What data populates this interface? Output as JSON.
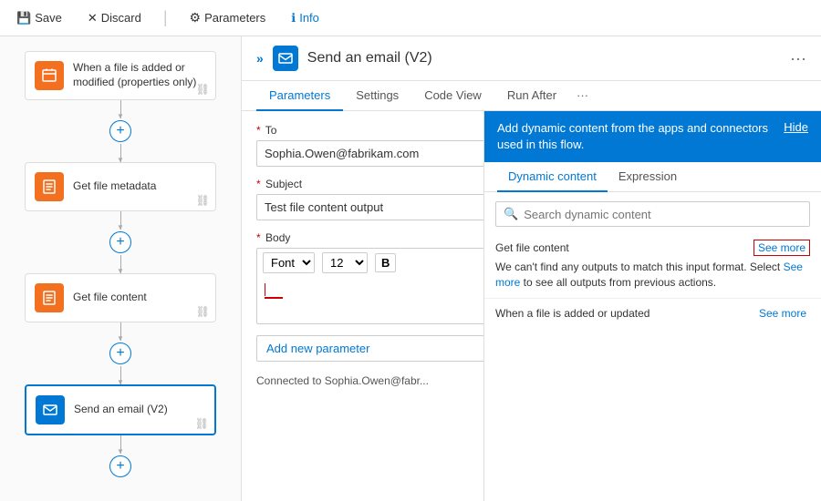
{
  "toolbar": {
    "save_label": "Save",
    "discard_label": "Discard",
    "parameters_label": "Parameters",
    "info_label": "Info"
  },
  "sidebar": {
    "nodes": [
      {
        "id": "trigger",
        "label": "When a file is added or modified (properties only)",
        "icon": "📁",
        "active": false
      },
      {
        "id": "get-metadata",
        "label": "Get file metadata",
        "icon": "📋",
        "active": false
      },
      {
        "id": "get-content",
        "label": "Get file content",
        "icon": "📄",
        "active": false
      },
      {
        "id": "send-email",
        "label": "Send an email (V2)",
        "icon": "✉",
        "active": true
      }
    ]
  },
  "action": {
    "title": "Send an email (V2)",
    "icon": "✉"
  },
  "tabs": {
    "items": [
      "Parameters",
      "Settings",
      "Code View",
      "Run After"
    ],
    "active": "Parameters"
  },
  "form": {
    "to_label": "To",
    "to_value": "Sophia.Owen@fabrikam.com",
    "subject_label": "Subject",
    "subject_value": "Test file content output",
    "body_label": "Body",
    "body_font": "Font",
    "body_size": "12",
    "add_param_label": "Add new parameter",
    "connected_text": "Connected to  Sophia.Owen@fabr..."
  },
  "dynamic_panel": {
    "header_text": "Add dynamic content from the apps and connectors used in this flow.",
    "hide_label": "Hide",
    "tabs": [
      "Dynamic content",
      "Expression"
    ],
    "active_tab": "Dynamic content",
    "search_placeholder": "Search dynamic content",
    "sections": [
      {
        "title": "Get file content",
        "see_more_label": "See more",
        "has_border": true,
        "desc": "We can't find any outputs to match this input format. Select See more to see all outputs from previous actions.",
        "see_more_inline": "See more"
      }
    ],
    "when_file_section": {
      "title": "When a file is added or updated",
      "see_more_label": "See more"
    }
  }
}
